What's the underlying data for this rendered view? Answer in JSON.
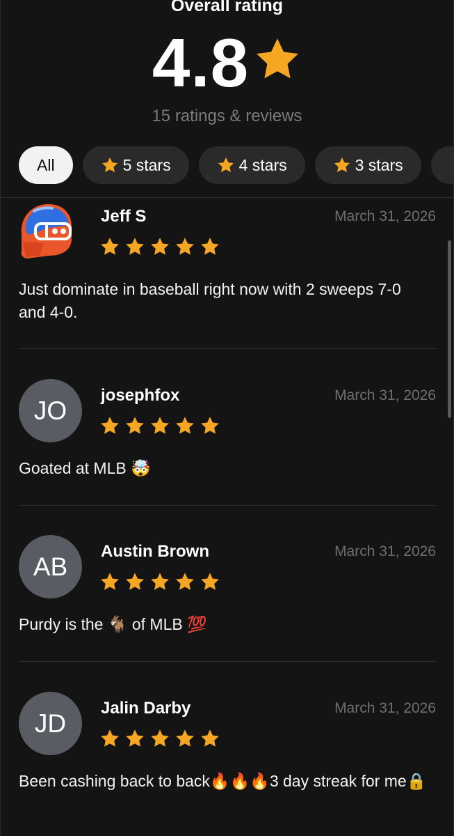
{
  "header": {
    "title": "Overall rating",
    "rating": "4.8",
    "count_text": "15 ratings & reviews",
    "star_color": "#F5A623"
  },
  "filters": [
    {
      "label": "All",
      "active": true
    },
    {
      "label": "5 stars",
      "active": false
    },
    {
      "label": "4 stars",
      "active": false
    },
    {
      "label": "3 stars",
      "active": false
    }
  ],
  "reviews": [
    {
      "author": "Jeff S",
      "avatar_type": "football-helmet-image",
      "date": "March 31, 2026",
      "stars": 5,
      "text": "Just dominate in baseball right now with 2 sweeps 7-0 and 4-0."
    },
    {
      "author": "josephfox",
      "avatar_initials": "JO",
      "date": "March 31, 2026",
      "stars": 5,
      "text": "Goated at MLB 🤯"
    },
    {
      "author": "Austin Brown",
      "avatar_initials": "AB",
      "date": "March 31, 2026",
      "stars": 5,
      "text": "Purdy is the 🐐 of MLB 💯"
    },
    {
      "author": "Jalin Darby",
      "avatar_initials": "JD",
      "date": "March 31, 2026",
      "stars": 5,
      "text": "Been cashing back to back🔥🔥🔥3 day streak for me🔒"
    }
  ]
}
